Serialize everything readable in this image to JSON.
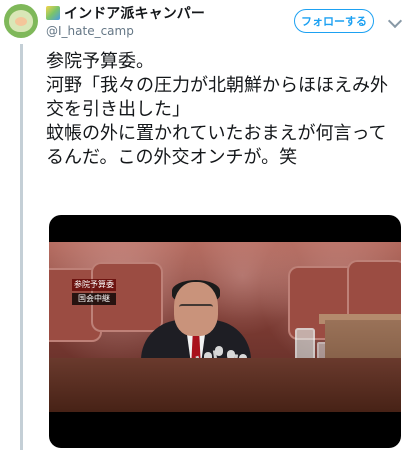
{
  "author": {
    "display_name": "インドア派キャンパー",
    "handle": "@I_hate_camp",
    "avatar_icon": "avatar-image",
    "name_icon": "flag-emoji-icon"
  },
  "actions": {
    "follow_label": "フォローする",
    "menu_icon": "chevron-down-icon"
  },
  "tweet": {
    "line1": "参院予算委。",
    "line2": "河野「我々の圧力が北朝鮮からほほえみ外交を引き出した」",
    "line3": "蚊帳の外に置かれていたおまえが何言ってるんだ。この外交オンチが。笑"
  },
  "media": {
    "caption_top": "参院予算委",
    "caption_bottom": "国会中継"
  },
  "colors": {
    "accent": "#1da1f2",
    "text": "#14171a",
    "muted": "#657786"
  }
}
